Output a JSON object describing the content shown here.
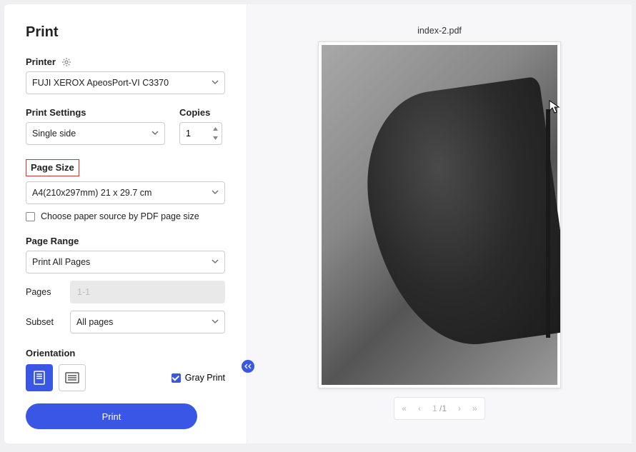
{
  "title": "Print",
  "printer": {
    "label": "Printer",
    "value": "FUJI XEROX ApeosPort-VI C3370"
  },
  "printSettings": {
    "label": "Print Settings",
    "value": "Single side"
  },
  "copies": {
    "label": "Copies",
    "value": "1"
  },
  "pageSize": {
    "label": "Page Size",
    "value": "A4(210x297mm) 21 x 29.7 cm",
    "checkboxLabel": "Choose paper source by PDF page size"
  },
  "pageRange": {
    "label": "Page Range",
    "value": "Print All Pages",
    "pagesLabel": "Pages",
    "pagesPlaceholder": "1-1",
    "subsetLabel": "Subset",
    "subsetValue": "All pages"
  },
  "orientation": {
    "label": "Orientation"
  },
  "grayPrint": "Gray Print",
  "printButton": "Print",
  "preview": {
    "filename": "index-2.pdf",
    "page": "1",
    "total": "/1"
  }
}
